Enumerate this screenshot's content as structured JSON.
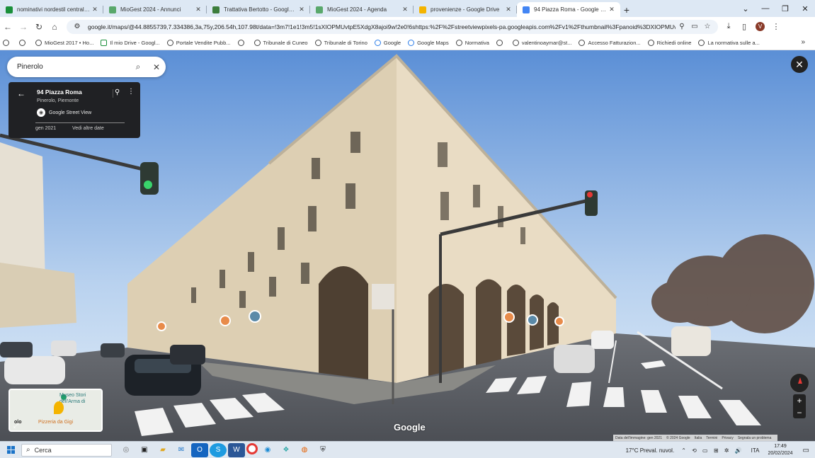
{
  "browser": {
    "tabs": [
      {
        "title": "nominativi nordestil centraline",
        "color": "#1a8f3a",
        "active": false
      },
      {
        "title": "MioGest 2024 - Annunci",
        "color": "#59a86b",
        "active": false
      },
      {
        "title": "Trattativa Bertotto - Google Dr",
        "color": "#3c7d3c",
        "active": false
      },
      {
        "title": "MioGest 2024 - Agenda",
        "color": "#59a86b",
        "active": false
      },
      {
        "title": "provenienze - Google Drive",
        "color": "#f4b400",
        "active": false
      },
      {
        "title": "94 Piazza Roma - Google Maps",
        "color": "#4285f4",
        "active": true
      }
    ],
    "new_tab_icon": "plus-icon",
    "url": "google.it/maps/@44.8855739,7.334386,3a,75y,206.54h,107.98t/data=!3m7!1e1!3m5!1sXIOPMUvtpE5XdgX8ajoi9w!2e0!6shttps:%2F%2Fstreetviewpixels-pa.googleapis.com%2Fv1%2Fthumbnail%3Fpanoid%3DXIOPMUvtpE5XdgX8ajoi9w%...",
    "avatar_letter": "V",
    "bookmarks": [
      {
        "label": "",
        "icon": "globe-icon"
      },
      {
        "label": "",
        "icon": "globe-icon"
      },
      {
        "label": "MioGest 2017 • Ho...",
        "icon": "globe-icon"
      },
      {
        "label": "Il mio Drive - Googl...",
        "icon": "drive-icon"
      },
      {
        "label": "Portale Vendite Pubb...",
        "icon": "globe-icon"
      },
      {
        "label": "",
        "icon": "globe-icon"
      },
      {
        "label": "Tribunale di Cuneo",
        "icon": "globe-icon"
      },
      {
        "label": "Tribunale di Torino",
        "icon": "globe-icon"
      },
      {
        "label": "Google",
        "icon": "google-icon"
      },
      {
        "label": "Google Maps",
        "icon": "maps-icon"
      },
      {
        "label": "Normativa",
        "icon": "globe-icon"
      },
      {
        "label": "",
        "icon": "globe-icon"
      },
      {
        "label": "valentinoaymar@st...",
        "icon": "globe-icon"
      },
      {
        "label": "Accesso Fatturazion...",
        "icon": "globe-icon"
      },
      {
        "label": "Richiedi online",
        "icon": "globe-icon"
      },
      {
        "label": "La normativa sulle a...",
        "icon": "check-icon"
      }
    ]
  },
  "maps": {
    "search_value": "Pinerolo",
    "place": {
      "address": "94 Piazza Roma",
      "city": "Pinerolo, Piemonte",
      "source": "Google Street View",
      "date": "gen 2021",
      "more_dates": "Vedi altre date"
    },
    "minimap": {
      "label1": "Museo Stori",
      "label2": "dell'Arma di",
      "label3": "Pizzeria da Gigi",
      "label4": "olo"
    },
    "google_logo": "Google",
    "attribution": [
      "Data dell'immagine: gen 2021",
      "© 2024 Google",
      "Italia",
      "Termini",
      "Privacy",
      "Segnala un problema"
    ]
  },
  "taskbar": {
    "search_placeholder": "Cerca",
    "weather": "17°C  Preval. nuvol.",
    "language": "ITA",
    "time": "17:49",
    "date": "20/02/2024"
  }
}
